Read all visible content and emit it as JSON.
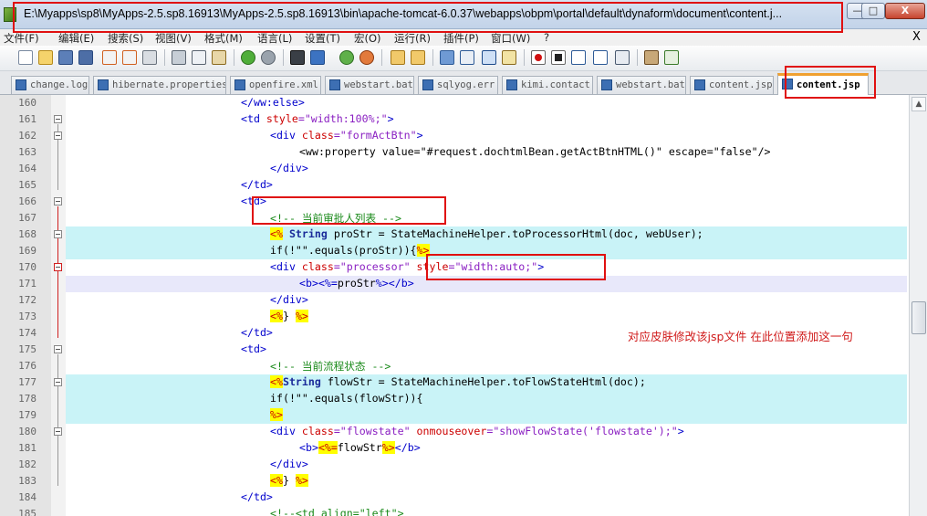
{
  "window": {
    "title": "E:\\Myapps\\sp8\\MyApps-2.5.sp8.16913\\MyApps-2.5.sp8.16913\\bin\\apache-tomcat-6.0.37\\webapps\\obpm\\portal\\default\\dynaform\\document\\content.j...",
    "minimize_glyph": "—",
    "maximize_glyph": "□",
    "close_glyph": "X"
  },
  "menu": {
    "items": [
      "文件(F)",
      "编辑(E)",
      "搜索(S)",
      "视图(V)",
      "格式(M)",
      "语言(L)",
      "设置(T)",
      "宏(O)",
      "运行(R)",
      "插件(P)",
      "窗口(W)",
      "?"
    ],
    "close_glyph": "X"
  },
  "toolbar": {
    "icons": [
      "new-file-icon",
      "open-file-icon",
      "save-icon",
      "save-all-icon",
      "close-file-icon",
      "close-all-icon",
      "print-icon",
      "cut-icon",
      "copy-icon",
      "paste-icon",
      "undo-icon",
      "redo-icon",
      "find-icon",
      "replace-icon",
      "zoom-in-icon",
      "zoom-out-icon",
      "sync-v-icon",
      "sync-h-icon",
      "word-wrap-icon",
      "show-all-chars-icon",
      "indent-guide-icon",
      "doc-map-icon",
      "record-macro-icon",
      "stop-macro-icon",
      "play-macro-icon",
      "run-macro-multiple-icon",
      "save-macro-icon",
      "trim-icon",
      "spellcheck-icon"
    ]
  },
  "tabs": [
    {
      "label": "change.log",
      "active": false
    },
    {
      "label": "hibernate.properties",
      "active": false
    },
    {
      "label": "openfire.xml",
      "active": false
    },
    {
      "label": "webstart.bat",
      "active": false
    },
    {
      "label": "sqlyog.err",
      "active": false
    },
    {
      "label": "kimi.contact",
      "active": false
    },
    {
      "label": "webstart.bat",
      "active": false
    },
    {
      "label": "content.jsp",
      "active": false
    },
    {
      "label": "content.jsp",
      "active": true
    }
  ],
  "editor": {
    "lines": [
      {
        "num": "160"
      },
      {
        "num": "161"
      },
      {
        "num": "162"
      },
      {
        "num": "163"
      },
      {
        "num": "164"
      },
      {
        "num": "165"
      },
      {
        "num": "166"
      },
      {
        "num": "167"
      },
      {
        "num": "168"
      },
      {
        "num": "169"
      },
      {
        "num": "170"
      },
      {
        "num": "171"
      },
      {
        "num": "172"
      },
      {
        "num": "173"
      },
      {
        "num": "174"
      },
      {
        "num": "175"
      },
      {
        "num": "176"
      },
      {
        "num": "177"
      },
      {
        "num": "178"
      },
      {
        "num": "179"
      },
      {
        "num": "180"
      },
      {
        "num": "181"
      },
      {
        "num": "182"
      },
      {
        "num": "183"
      },
      {
        "num": "184"
      },
      {
        "num": "185"
      }
    ],
    "code": {
      "l160": "</ww:else>",
      "l161_tag": "<td",
      "l161_attr": " style",
      "l161_val": "=\"width:100%;\"",
      "l161_end": ">",
      "l162_tag": "<div",
      "l162_attr": " class",
      "l162_val": "=\"formActBtn\"",
      "l162_end": ">",
      "l163_tag": "<ww:property",
      "l163_rest": " value=\"#request.dochtmlBean.getActBtnHTML()\" escape=\"false\"/>",
      "l164": "</div>",
      "l165": "</td>",
      "l166": "<td>",
      "l167": "<!-- 当前审批人列表 -->",
      "l168_open": "<%",
      "l168_kw": " String",
      "l168_rest": " proStr = StateMachineHelper.toProcessorHtml(doc, webUser);",
      "l169_rest": "if(!\"\".equals(proStr)){",
      "l169_close": "%>",
      "l170_tag": "<div",
      "l170_attr": " class",
      "l170_val": "=\"processor\"",
      "l170_attr2": " style",
      "l170_val2": "=\"width:auto;\"",
      "l170_end": ">",
      "l171_b": "<b>",
      "l171_jsp": "<%=",
      "l171_mid": "proStr",
      "l171_jspc": "%>",
      "l171_be": "</b>",
      "l172": "</div>",
      "l173_open": "<%",
      "l173_mid": "} ",
      "l173_close": "%>",
      "l174": "</td>",
      "l175": "<td>",
      "l176": "<!-- 当前流程状态 -->",
      "l177_open": "<%",
      "l177_kw": "String",
      "l177_rest": " flowStr = StateMachineHelper.toFlowStateHtml(doc);",
      "l178": "if(!\"\".equals(flowStr)){",
      "l179": "%>",
      "l180_tag": "<div",
      "l180_attr": " class",
      "l180_val": "=\"flowstate\"",
      "l180_attr2": " onmouseover",
      "l180_val2": "=\"showFlowState('flowstate');\"",
      "l180_end": ">",
      "l181_b": "<b>",
      "l181_jsp": "<%=",
      "l181_mid": "flowStr",
      "l181_jspc": "%>",
      "l181_be": "</b>",
      "l182": "</div>",
      "l183_open": "<%",
      "l183_mid": "} ",
      "l183_close": "%>",
      "l184": "</td>",
      "l185": "<!--<td align=\"left\">"
    }
  },
  "annotation": {
    "note": "对应皮肤修改该jsp文件  在此位置添加这一句",
    "color": "#e01010"
  }
}
